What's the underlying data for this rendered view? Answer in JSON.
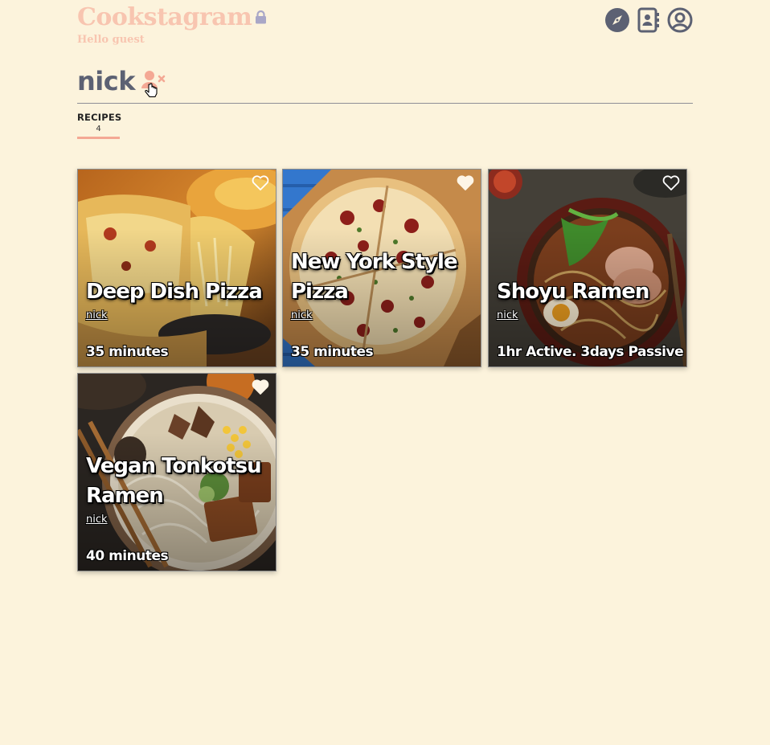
{
  "app": {
    "name": "Cookstagram",
    "greeting": "Hello guest",
    "colors": {
      "background": "#fcf3dc",
      "brand": "#f8c5b0",
      "accent": "#f4a894",
      "icon": "#5c6173"
    }
  },
  "nav": {
    "icons": [
      "compass-icon",
      "address-book-icon",
      "user-circle-icon"
    ]
  },
  "profile": {
    "username": "nick",
    "action_icon": "unfollow-user-icon"
  },
  "stats": {
    "recipes_label": "RECIPES",
    "recipes_count": "4"
  },
  "recipes": [
    {
      "title": "Deep Dish Pizza",
      "author": "nick",
      "time": "35 minutes",
      "liked": false
    },
    {
      "title": "New York Style Pizza",
      "author": "nick",
      "time": "35 minutes",
      "liked": true
    },
    {
      "title": "Shoyu Ramen",
      "author": "nick",
      "time": "1hr Active. 3days Passive",
      "liked": false
    },
    {
      "title": "Vegan Tonkotsu Ramen",
      "author": "nick",
      "time": "40 minutes",
      "liked": true
    }
  ]
}
